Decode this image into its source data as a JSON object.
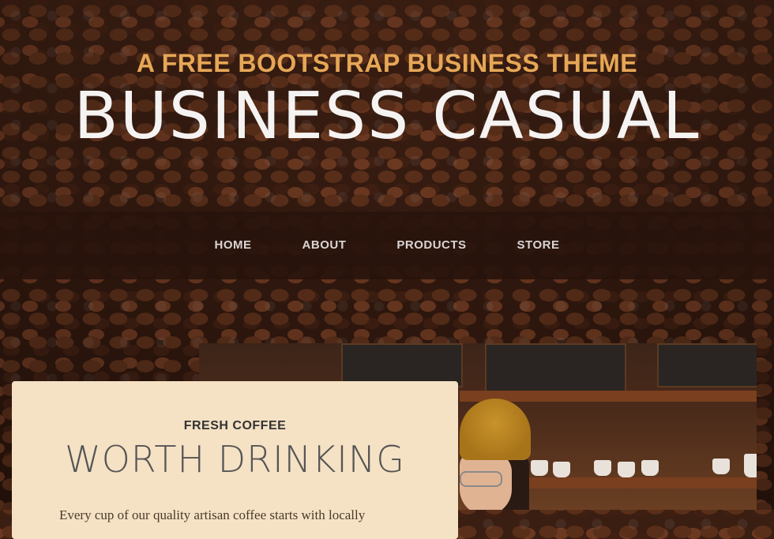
{
  "heading": {
    "upper": "A Free Bootstrap Business Theme",
    "lower": "Business Casual"
  },
  "nav": {
    "items": [
      {
        "label": "Home"
      },
      {
        "label": "About"
      },
      {
        "label": "Products"
      },
      {
        "label": "Store"
      }
    ]
  },
  "intro": {
    "upper": "Fresh Coffee",
    "lower": "Worth Drinking",
    "paragraph": "Every cup of our quality artisan coffee starts with locally"
  },
  "colors": {
    "accent": "#e6a756",
    "nav_bg": "#28140c",
    "card_bg": "#f5e1c4"
  }
}
